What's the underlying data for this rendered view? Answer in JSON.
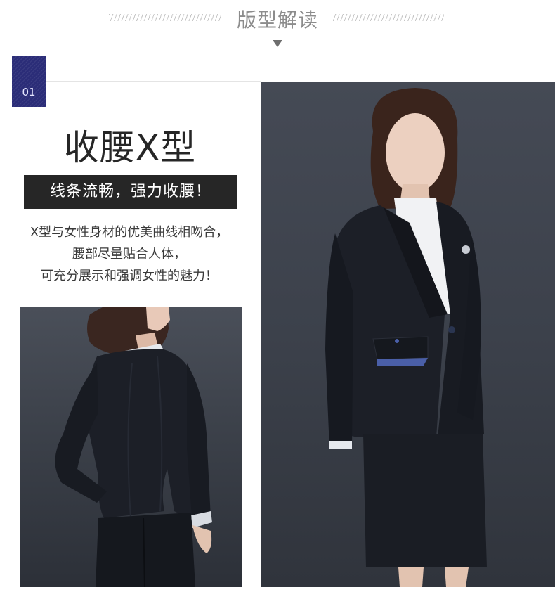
{
  "header": {
    "title": "版型解读"
  },
  "section": {
    "number": "01"
  },
  "headline": "收腰X型",
  "banner": "线条流畅，强力收腰！",
  "description": {
    "lines": [
      "X型与女性身材的优美曲线相吻合，",
      "腰部尽量贴合人体，",
      "可充分展示和强调女性的魅力！"
    ]
  },
  "colors": {
    "badge": "#2b2d78",
    "banner": "#262626",
    "suit": "#1c1f27",
    "pocket_accent": "#4a5fa8"
  }
}
